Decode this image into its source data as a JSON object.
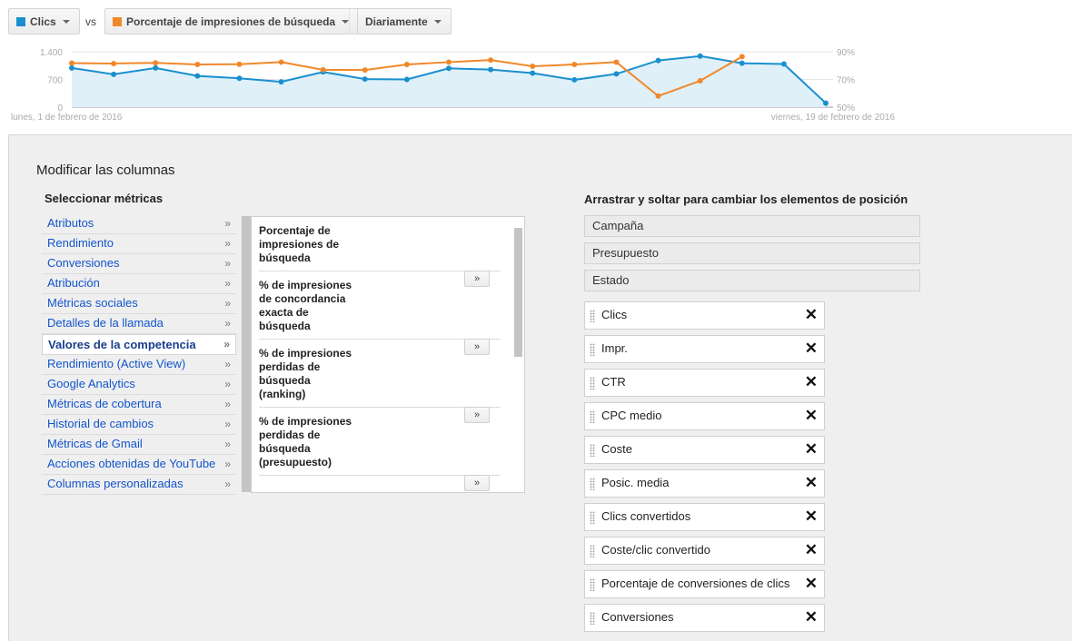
{
  "toolbar": {
    "metric1": {
      "label": "Clics",
      "color": "#1a8fcf"
    },
    "vs": "vs",
    "metric2": {
      "label": "Porcentaje de impresiones de búsqueda",
      "color": "#f0882a"
    },
    "period": {
      "label": "Diariamente"
    }
  },
  "chart_data": {
    "type": "line",
    "x_start_label": "lunes, 1 de febrero de 2016",
    "x_end_label": "viernes, 19 de febrero de 2016",
    "y_left_ticks": [
      "1.400",
      "700",
      "0"
    ],
    "y_right_ticks": [
      "90%",
      "70%",
      "50%"
    ],
    "y_left_range": [
      0,
      1400
    ],
    "y_right_range": [
      50,
      90
    ],
    "series": [
      {
        "name": "Clics",
        "axis": "left",
        "color": "#1a8fcf",
        "values": [
          990,
          830,
          990,
          790,
          730,
          640,
          890,
          710,
          700,
          980,
          950,
          860,
          690,
          840,
          1180,
          1290,
          1110,
          1090,
          100
        ]
      },
      {
        "name": "Porcentaje de impresiones de búsqueda",
        "axis": "right",
        "color": "#f0882a",
        "values": [
          81.8,
          81.5,
          82.0,
          80.8,
          81.0,
          82.5,
          77.0,
          76.8,
          80.8,
          82.5,
          84.0,
          79.5,
          80.8,
          82.5,
          58.0,
          69.0,
          86.5
        ]
      }
    ]
  },
  "panel": {
    "title": "Modificar las columnas",
    "select_title": "Seleccionar métricas",
    "drag_title": "Arrastrar y soltar para cambiar los elementos de posición",
    "categories": [
      {
        "label": "Atributos"
      },
      {
        "label": "Rendimiento"
      },
      {
        "label": "Conversiones"
      },
      {
        "label": "Atribución"
      },
      {
        "label": "Métricas sociales"
      },
      {
        "label": "Detalles de la llamada"
      },
      {
        "label": "Valores de la competencia"
      },
      {
        "label": "Rendimiento (Active View)"
      },
      {
        "label": "Google Analytics"
      },
      {
        "label": "Métricas de cobertura"
      },
      {
        "label": "Historial de cambios"
      },
      {
        "label": "Métricas de Gmail"
      },
      {
        "label": "Acciones obtenidas de YouTube"
      },
      {
        "label": "Columnas personalizadas"
      }
    ],
    "category_arrow": "»",
    "selected_category": "Valores de la competencia",
    "metrics": [
      {
        "text": "Porcentaje de impresiones de búsqueda"
      },
      {
        "text": "% de impresiones de concordancia exacta de búsqueda"
      },
      {
        "text": "% de impresiones perdidas de búsqueda (ranking)"
      },
      {
        "text": "% de impresiones perdidas de búsqueda (presupuesto)"
      }
    ],
    "add_button": "»",
    "fixed_columns": [
      "Campaña",
      "Presupuesto",
      "Estado"
    ],
    "selected_columns": [
      "Clics",
      "Impr.",
      "CTR",
      "CPC medio",
      "Coste",
      "Posic. media",
      "Clics convertidos",
      "Coste/clic convertido",
      "Porcentaje de conversiones de clics",
      "Conversiones"
    ],
    "remove_symbol": "✕"
  }
}
